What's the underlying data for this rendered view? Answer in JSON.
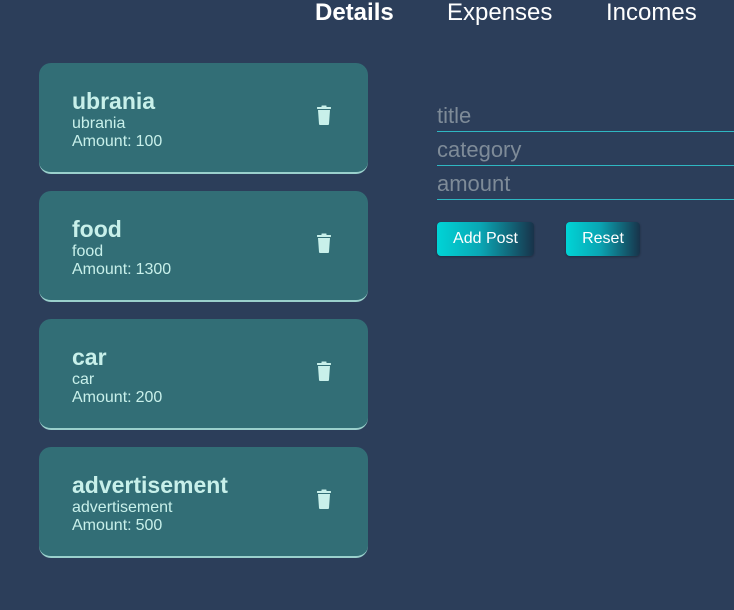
{
  "nav": {
    "tabs": [
      {
        "label": "Details",
        "active": true
      },
      {
        "label": "Expenses",
        "active": false
      },
      {
        "label": "Incomes",
        "active": false
      }
    ]
  },
  "posts": [
    {
      "title": "ubrania",
      "category": "ubrania",
      "amount_label": "Amount:",
      "amount": "100"
    },
    {
      "title": "food",
      "category": "food",
      "amount_label": "Amount:",
      "amount": "1300"
    },
    {
      "title": "car",
      "category": "car",
      "amount_label": "Amount:",
      "amount": "200"
    },
    {
      "title": "advertisement",
      "category": "advertisement",
      "amount_label": "Amount:",
      "amount": "500"
    }
  ],
  "form": {
    "title_placeholder": "title",
    "category_placeholder": "category",
    "amount_placeholder": "amount",
    "add_button": "Add Post",
    "reset_button": "Reset"
  },
  "icons": {
    "delete": "trash-icon"
  },
  "colors": {
    "background": "#2c3e5a",
    "card": "#326e76",
    "accent": "#00d4d6",
    "card_text": "#c8f0ea"
  }
}
